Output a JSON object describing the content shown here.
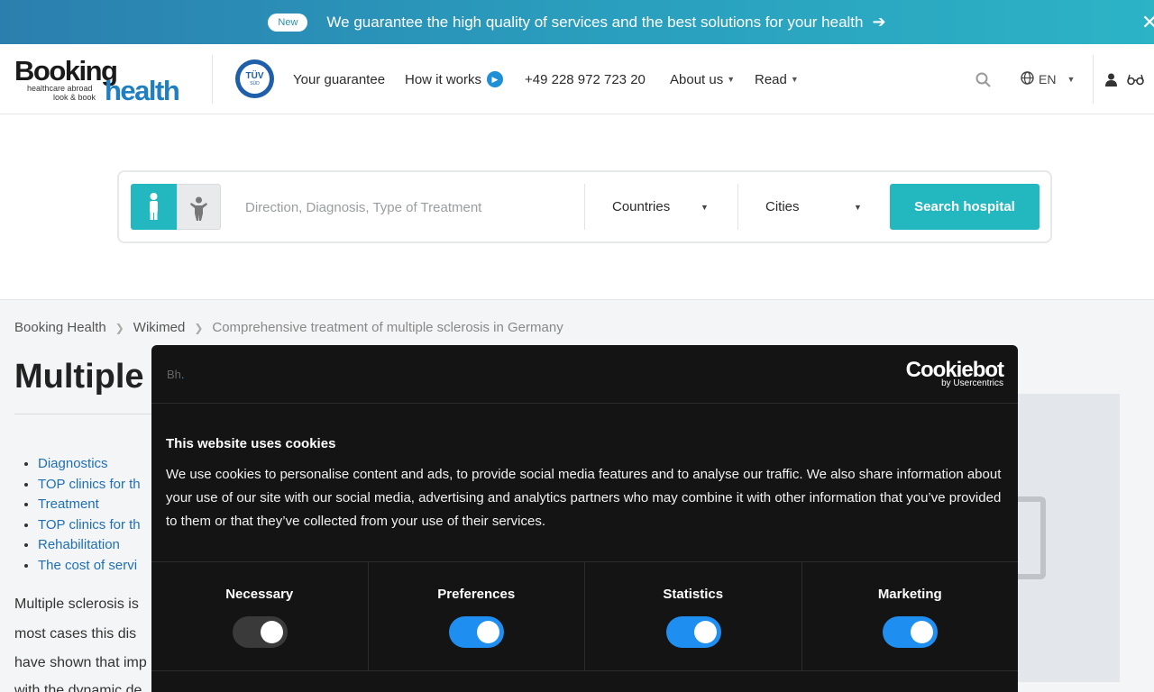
{
  "banner": {
    "badge": "New",
    "text": "We guarantee the high quality of services and the best solutions for your health",
    "arrow_icon": "arrow-right-icon",
    "close_icon": "close-icon"
  },
  "header": {
    "logo": {
      "word1": "Booking",
      "word2": "health",
      "tagline1": "healthcare abroad",
      "tagline2": "look & book"
    },
    "tuv": {
      "main": "TÜV",
      "sub": "SÜD"
    },
    "nav": {
      "guarantee": "Your guarantee",
      "how_it_works": "How it works",
      "phone": "+49 228 972 723 20",
      "about": "About us",
      "read": "Read"
    },
    "language": "EN"
  },
  "search": {
    "placeholder": "Direction, Diagnosis, Type of Treatment",
    "countries": "Countries",
    "cities": "Cities",
    "button": "Search hospital"
  },
  "breadcrumb": [
    "Booking Health",
    "Wikimed",
    "Comprehensive treatment of multiple sclerosis in Germany"
  ],
  "article": {
    "title": "Multiple s",
    "toc": [
      "Diagnostics",
      "TOP clinics for th",
      "Treatment",
      "TOP clinics for th",
      "Rehabilitation",
      "The cost of servi"
    ],
    "lines": [
      "Multiple sclerosis is",
      "most cases this dis",
      "have shown that imp",
      "with the dynamic de"
    ]
  },
  "cookie": {
    "brand_short": "Bh",
    "brand_dot": ".",
    "cookiebot": "Cookiebot",
    "cookiebot_sub": "by Usercentrics",
    "heading": "This website uses cookies",
    "body": "We use cookies to personalise content and ads, to provide social media features and to analyse our traffic. We also share information about your use of our site with our social media, advertising and analytics partners who may combine it with other information that you’ve provided to them or that they’ve collected from your use of their services.",
    "categories": [
      {
        "label": "Necessary",
        "enabled": true,
        "locked": true
      },
      {
        "label": "Preferences",
        "enabled": true,
        "locked": false
      },
      {
        "label": "Statistics",
        "enabled": true,
        "locked": false
      },
      {
        "label": "Marketing",
        "enabled": true,
        "locked": false
      }
    ]
  }
}
